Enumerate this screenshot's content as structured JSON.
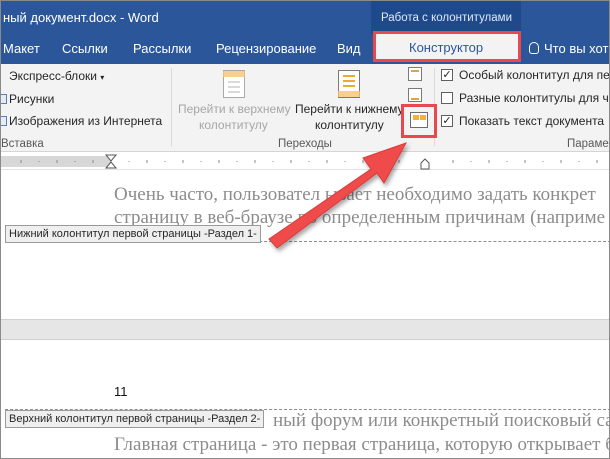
{
  "window": {
    "title": "ный документ.docx - Word",
    "context_group": "Работа с колонтитулами"
  },
  "tabs": {
    "items": [
      "Макет",
      "Ссылки",
      "Рассылки",
      "Рецензирование",
      "Вид"
    ],
    "active": "Конструктор",
    "tell_me": "Что вы хот"
  },
  "ribbon": {
    "insert_group": {
      "express_blocks": "Экспресс-блоки",
      "pictures": "Рисунки",
      "online_pictures": "Изображения из Интернета",
      "group_label": "Вставка"
    },
    "navigation_group": {
      "goto_header_line1": "Перейти к верхнему",
      "goto_header_line2": "колонтитулу",
      "goto_footer_line1": "Перейти к нижнему",
      "goto_footer_line2": "колонтитулу",
      "group_label": "Переходы"
    },
    "options_group": {
      "different_first": "Особый колонтитул для пе",
      "different_odd_even": "Разные колонтитулы для че",
      "show_text": "Показать текст документа",
      "different_first_checked": true,
      "different_odd_even_checked": false,
      "show_text_checked": true,
      "group_label": "Параме"
    }
  },
  "document": {
    "line1": "Очень часто, пользовател     ывает необходимо задать конкрет",
    "line2": "страницу в веб-браузе     по определенным причинам (наприме",
    "footer_tag": "Нижний колонтитул первой страницы -Раздел 1-",
    "page_number": "11",
    "header_tag": "Верхний колонтитул первой страницы -Раздел 2-",
    "line3": "ный форум или конкретный поисковый са",
    "line4": "Главная страница - это первая страница, которую открывает б"
  },
  "colors": {
    "word_blue": "#2b579a",
    "highlight_red": "#e9484f"
  }
}
